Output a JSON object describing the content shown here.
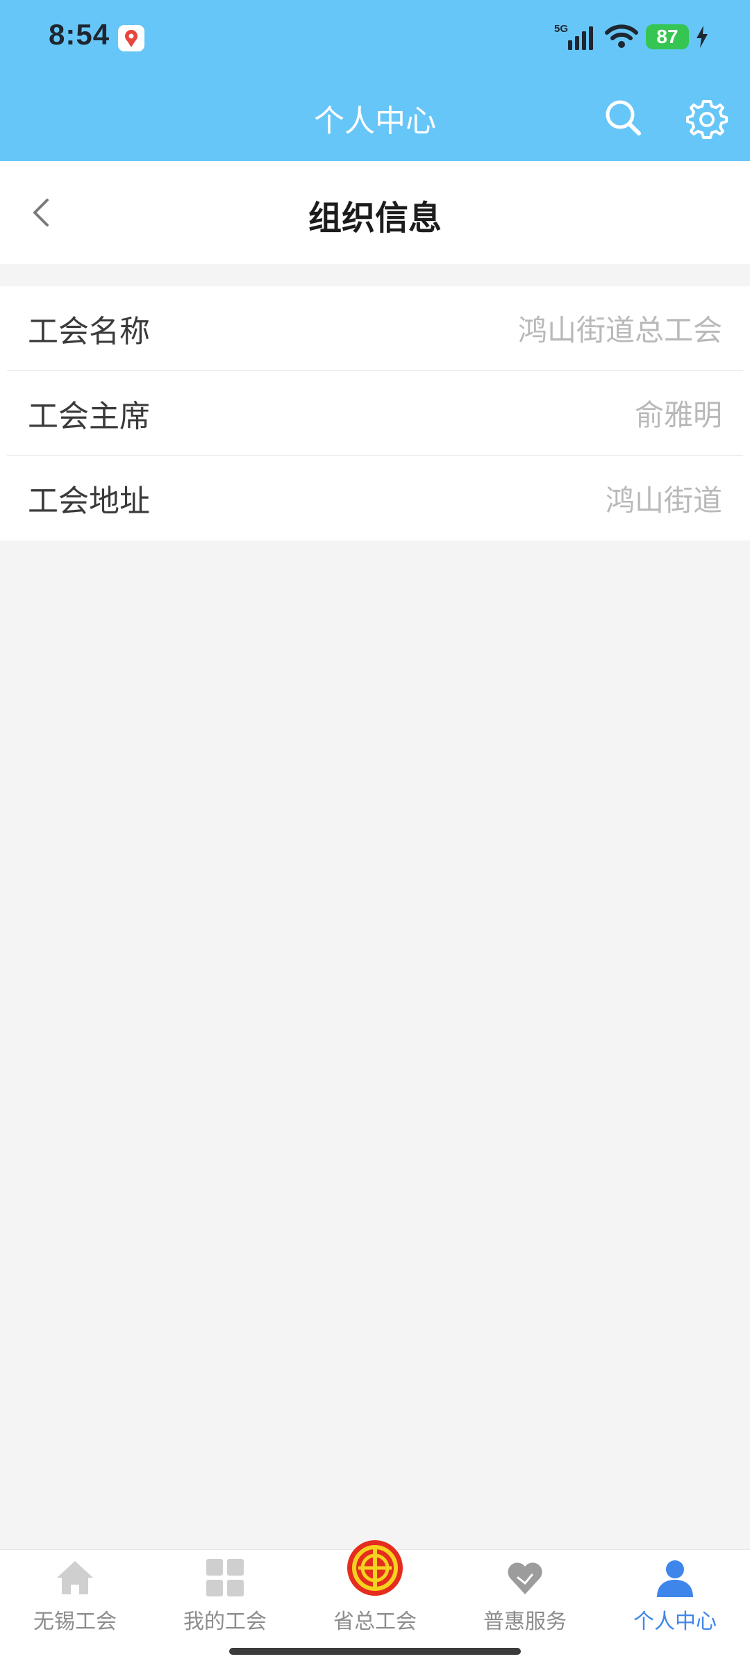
{
  "status_bar": {
    "time": "8:54",
    "network": "5G",
    "battery": "87"
  },
  "nav": {
    "title": "个人中心"
  },
  "subheader": {
    "title": "组织信息"
  },
  "info_rows": [
    {
      "label": "工会名称",
      "value": "鸿山街道总工会"
    },
    {
      "label": "工会主席",
      "value": "俞雅明"
    },
    {
      "label": "工会地址",
      "value": "鸿山街道"
    }
  ],
  "tabs": [
    {
      "label": "无锡工会",
      "icon": "home-icon",
      "active": false
    },
    {
      "label": "我的工会",
      "icon": "grid-icon",
      "active": false
    },
    {
      "label": "省总工会",
      "icon": "union-emblem-icon",
      "active": false
    },
    {
      "label": "普惠服务",
      "icon": "heart-icon",
      "active": false
    },
    {
      "label": "个人中心",
      "icon": "person-icon",
      "active": true
    }
  ],
  "colors": {
    "header_bg": "#67c6f8",
    "active_tab": "#3f86ea",
    "inactive_tab": "#8c8c8c",
    "value_text": "#b9b9b9",
    "battery": "#35c553"
  }
}
